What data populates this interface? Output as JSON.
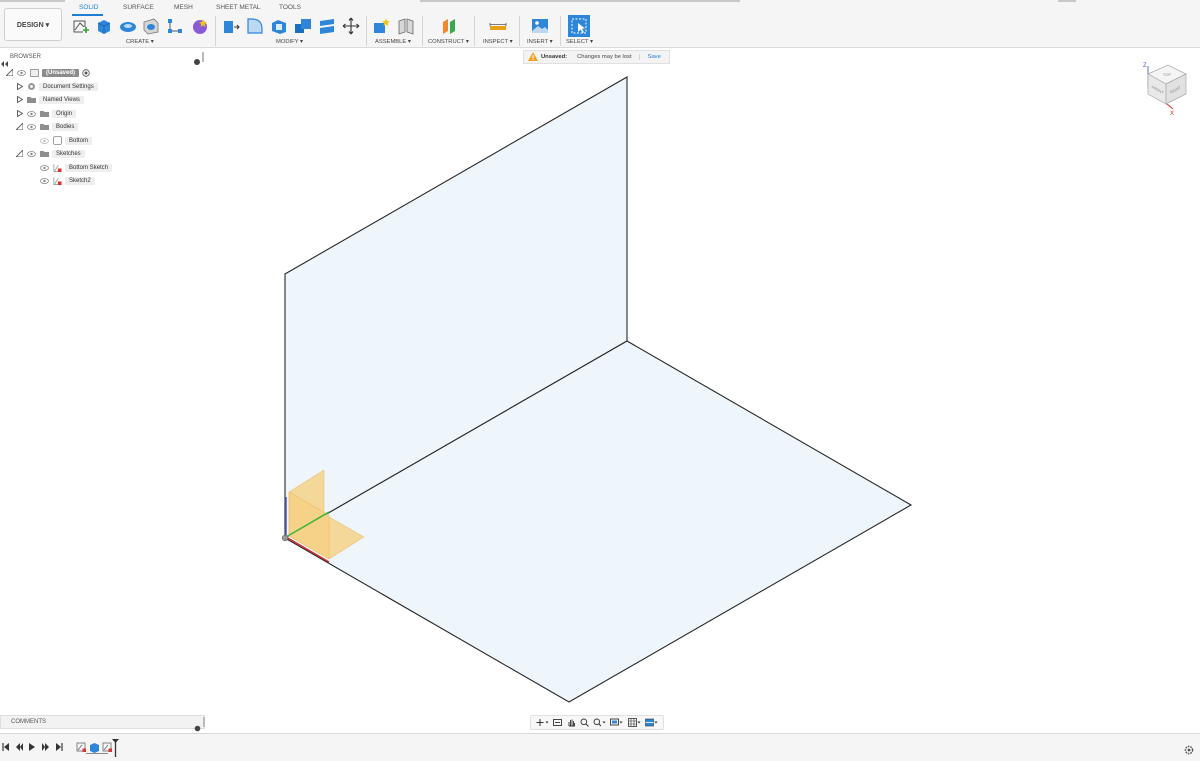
{
  "toolbar": {
    "design_button": "DESIGN ▾",
    "workspace_tabs": [
      "SOLID",
      "SURFACE",
      "MESH",
      "SHEET METAL",
      "TOOLS"
    ],
    "groups": {
      "create": "CREATE ▾",
      "modify": "MODIFY ▾",
      "assemble": "ASSEMBLE ▾",
      "construct": "CONSTRUCT ▾",
      "inspect": "INSPECT ▾",
      "insert": "INSERT ▾",
      "select": "SELECT ▾"
    },
    "accent_color": "#1d7fd1"
  },
  "browser": {
    "title": "BROWSER",
    "items": [
      {
        "label": "(Unsaved)"
      },
      {
        "label": "Document Settings"
      },
      {
        "label": "Named Views"
      },
      {
        "label": "Origin"
      },
      {
        "label": "Bodies"
      },
      {
        "label": "Bottom"
      },
      {
        "label": "Sketches"
      },
      {
        "label": "Bottom Sketch"
      },
      {
        "label": "Sketch2"
      }
    ]
  },
  "status": {
    "unsaved_title": "Unsaved:",
    "unsaved_message": "Changes may be lost",
    "save_label": "Save"
  },
  "viewcube": {
    "axes": [
      "Z",
      "X"
    ],
    "faces": [
      "TOP",
      "FRONT",
      "RIGHT"
    ]
  },
  "comments": {
    "title": "COMMENTS"
  },
  "icons": {
    "collapse_panel": "double-chevron-left-icon",
    "panel_options": "gear-dot-icon",
    "warning": "warning-triangle-icon"
  },
  "colors": {
    "plane_fill": "#eef6fc",
    "origin_plane": "#f5cd78",
    "x_axis": "#d0282a",
    "y_axis": "#3cb93c",
    "z_axis": "#4a5bd6",
    "warning": "#f0a020"
  }
}
